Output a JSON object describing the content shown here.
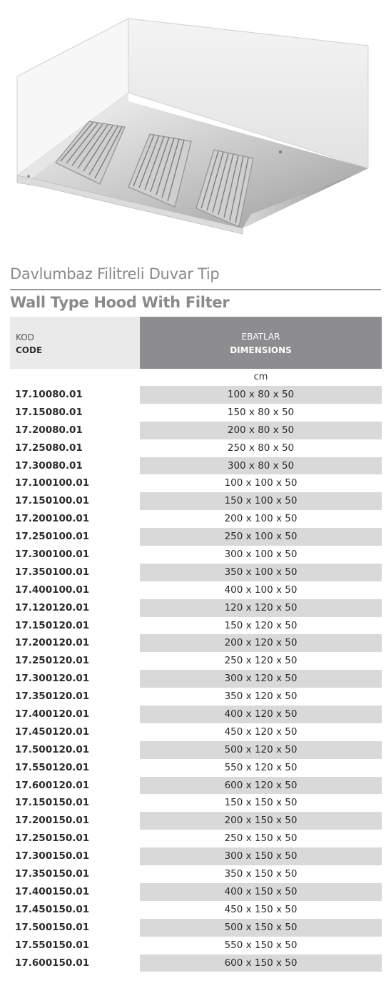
{
  "title_tr": "Davlumbaz Filitreli Duvar Tip",
  "title_en": "Wall Type Hood With Filter",
  "table": {
    "header": {
      "code_tr": "KOD",
      "code_en": "CODE",
      "dim_tr": "EBATLAR",
      "dim_en": "DIMENSIONS"
    },
    "unit": "cm",
    "rows": [
      {
        "code": "17.10080.01",
        "dim": "100 x 80 x 50"
      },
      {
        "code": "17.15080.01",
        "dim": "150 x 80 x 50"
      },
      {
        "code": "17.20080.01",
        "dim": "200 x 80 x 50"
      },
      {
        "code": "17.25080.01",
        "dim": "250 x 80 x 50"
      },
      {
        "code": "17.30080.01",
        "dim": "300 x 80 x 50"
      },
      {
        "code": "17.100100.01",
        "dim": "100 x 100 x 50"
      },
      {
        "code": "17.150100.01",
        "dim": "150 x 100 x 50"
      },
      {
        "code": "17.200100.01",
        "dim": "200 x 100 x 50"
      },
      {
        "code": "17.250100.01",
        "dim": "250 x 100 x 50"
      },
      {
        "code": "17.300100.01",
        "dim": "300 x 100 x 50"
      },
      {
        "code": "17.350100.01",
        "dim": "350 x 100 x 50"
      },
      {
        "code": "17.400100.01",
        "dim": "400 x 100 x 50"
      },
      {
        "code": "17.120120.01",
        "dim": "120 x 120 x 50"
      },
      {
        "code": "17.150120.01",
        "dim": "150 x 120 x 50"
      },
      {
        "code": "17.200120.01",
        "dim": "200 x 120 x 50"
      },
      {
        "code": "17.250120.01",
        "dim": "250 x 120 x 50"
      },
      {
        "code": "17.300120.01",
        "dim": "300 x 120 x 50"
      },
      {
        "code": "17.350120.01",
        "dim": "350 x 120 x 50"
      },
      {
        "code": "17.400120.01",
        "dim": "400 x 120 x 50"
      },
      {
        "code": "17.450120.01",
        "dim": "450 x 120 x 50"
      },
      {
        "code": "17.500120.01",
        "dim": "500 x 120 x 50"
      },
      {
        "code": "17.550120.01",
        "dim": "550 x 120 x 50"
      },
      {
        "code": "17.600120.01",
        "dim": "600 x 120 x 50"
      },
      {
        "code": "17.150150.01",
        "dim": "150 x 150 x 50"
      },
      {
        "code": "17.200150.01",
        "dim": "200 x 150 x 50"
      },
      {
        "code": "17.250150.01",
        "dim": "250 x 150 x 50"
      },
      {
        "code": "17.300150.01",
        "dim": "300 x 150 x 50"
      },
      {
        "code": "17.350150.01",
        "dim": "350 x 150 x 50"
      },
      {
        "code": "17.400150.01",
        "dim": "400 x 150 x 50"
      },
      {
        "code": "17.450150.01",
        "dim": "450 x 150 x 50"
      },
      {
        "code": "17.500150.01",
        "dim": "500 x 150 x 50"
      },
      {
        "code": "17.550150.01",
        "dim": "550 x 150 x 50"
      },
      {
        "code": "17.600150.01",
        "dim": "600 x 150 x 50"
      }
    ]
  }
}
